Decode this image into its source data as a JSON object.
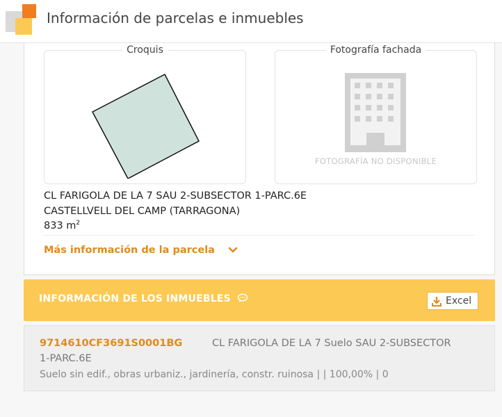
{
  "header": {
    "title": "Información de parcelas e inmuebles"
  },
  "parcel": {
    "sketch_title": "Croquis",
    "photo_title": "Fotografía fachada",
    "photo_unavailable": "FOTOGRAFÍA NO DISPONIBLE",
    "address_line1": "CL FARIGOLA DE LA 7 SAU 2-SUBSECTOR 1-PARC.6E",
    "address_line2": "CASTELLVELL DEL CAMP (TARRAGONA)",
    "area_value": "833 m",
    "area_exp": "2",
    "more_info_label": "Más información de la parcela"
  },
  "inmuebles": {
    "title": "INFORMACIÓN DE LOS INMUEBLES",
    "excel_label": "Excel",
    "items": [
      {
        "reference": "9714610CF3691S0001BG",
        "address": "CL FARIGOLA DE LA 7 Suelo SAU 2-SUBSECTOR",
        "address_cont": "1-PARC.6E",
        "detail": "Suelo sin edif., obras urbaniz., jardinería, constr. ruinosa | | 100,00% | 0"
      }
    ]
  },
  "colors": {
    "accent_orange": "#e08a1e",
    "bar_yellow": "#fcc954",
    "parcel_fill": "#cfe3dc"
  },
  "icons": [
    "app-logo-icon",
    "building-placeholder-icon",
    "chevron-down-icon",
    "chat-bubble-icon",
    "download-icon"
  ]
}
